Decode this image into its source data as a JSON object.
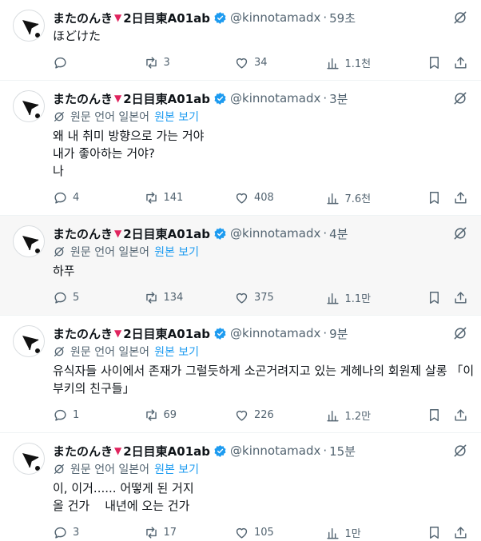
{
  "translate": {
    "label": "원문 언어 일본어",
    "show_original": "원본 보기"
  },
  "tweets": [
    {
      "name": "またのんき",
      "tag": "2日目東A01ab",
      "handle": "@kinnotamadx",
      "time": "59초",
      "translated": false,
      "lines": [
        "ほどけた"
      ],
      "replies": "",
      "reposts": "3",
      "likes": "34",
      "views": "1.1천"
    },
    {
      "name": "またのんき",
      "tag": "2日目東A01ab",
      "handle": "@kinnotamadx",
      "time": "3분",
      "translated": true,
      "lines": [
        "왜 내 취미 방향으로 가는 거야",
        "내가 좋아하는 거야?",
        "나"
      ],
      "replies": "4",
      "reposts": "141",
      "likes": "408",
      "views": "7.6천"
    },
    {
      "name": "またのんき",
      "tag": "2日目東A01ab",
      "handle": "@kinnotamadx",
      "time": "4분",
      "translated": true,
      "lines": [
        "하푸"
      ],
      "replies": "5",
      "reposts": "134",
      "likes": "375",
      "views": "1.1만"
    },
    {
      "name": "またのんき",
      "tag": "2日目東A01ab",
      "handle": "@kinnotamadx",
      "time": "9분",
      "translated": true,
      "lines": [
        "유식자들 사이에서 존재가 그럴듯하게 소곤거려지고 있는 게헤나의 회원제 살롱 「이",
        "부키의 친구들」"
      ],
      "replies": "1",
      "reposts": "69",
      "likes": "226",
      "views": "1.2만"
    },
    {
      "name": "またのんき",
      "tag": "2日目東A01ab",
      "handle": "@kinnotamadx",
      "time": "15분",
      "translated": true,
      "lines": [
        "이, 이거...... 어떻게 된 거지",
        "올 건가    내년에 오는 건가"
      ],
      "replies": "3",
      "reposts": "17",
      "likes": "105",
      "views": "1만"
    }
  ]
}
